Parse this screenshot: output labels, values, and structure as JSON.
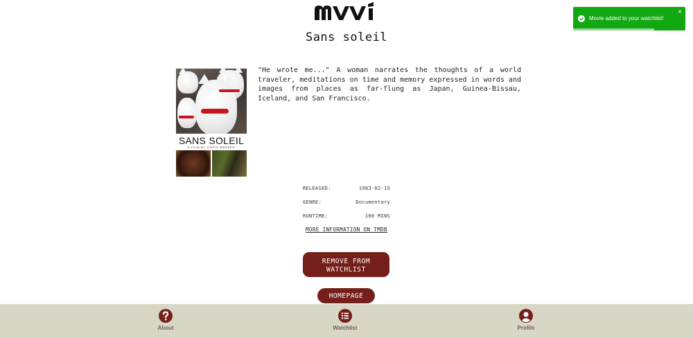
{
  "app": {
    "logo_text": "mvvi"
  },
  "movie": {
    "title": "Sans soleil",
    "poster": {
      "title": "SANS SOLEIL",
      "subtitle": "A FILM BY CHRIS MARKER"
    },
    "description": "\"He wrote me...\" A woman narrates the thoughts of a world traveler, meditations on time and memory expressed in words and images from places as far-flung as Japan, Guinea-Bissau, Iceland, and San Francisco.",
    "details": {
      "released_label": "RELEASED:",
      "released_value": "1983-02-15",
      "genre_label": "GENRE:",
      "genre_value": "Documentary",
      "runtime_label": "RUNTIME:",
      "runtime_value": "100 MINS"
    },
    "tmdb_link": "MORE INFORMATION ON TMDB"
  },
  "actions": {
    "remove_line1": "REMOVE FROM",
    "remove_line2": "WATCHLIST",
    "homepage": "HOMEPAGE"
  },
  "nav": {
    "items": [
      {
        "label": "About",
        "icon": "question-icon"
      },
      {
        "label": "Watchlist",
        "icon": "list-icon"
      },
      {
        "label": "Profile",
        "icon": "user-icon"
      }
    ]
  },
  "toast": {
    "message": "Movie added to your watchlist!",
    "close": "×",
    "progress": 0.72
  },
  "colors": {
    "accent": "#751f1a",
    "nav_bg": "#d8d6c5",
    "toast_bg": "#12a812"
  }
}
